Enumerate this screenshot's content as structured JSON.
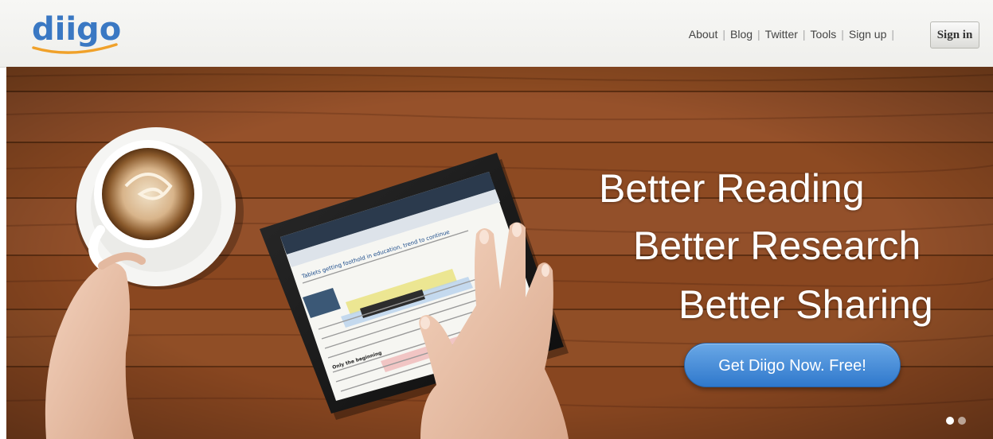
{
  "brand": {
    "name": "diigo",
    "logo_color": "#3a78c3",
    "swoosh_color": "#f0a12a"
  },
  "nav": {
    "links": [
      {
        "label": "About"
      },
      {
        "label": "Blog"
      },
      {
        "label": "Twitter"
      },
      {
        "label": "Tools"
      },
      {
        "label": "Sign up"
      }
    ],
    "separator": "|",
    "signin_label": "Sign in"
  },
  "hero": {
    "taglines": [
      "Better Reading",
      "Better Research",
      "Better Sharing"
    ],
    "cta_label": "Get Diigo Now. Free!",
    "cta_color": "#3f86d6",
    "wood_color": "#8a4a22",
    "tablet_article_title": "Tablets getting foothold in education, trend to continue",
    "tablet_section_heading": "Only the beginning",
    "slides": {
      "count": 2,
      "active_index": 0
    }
  }
}
